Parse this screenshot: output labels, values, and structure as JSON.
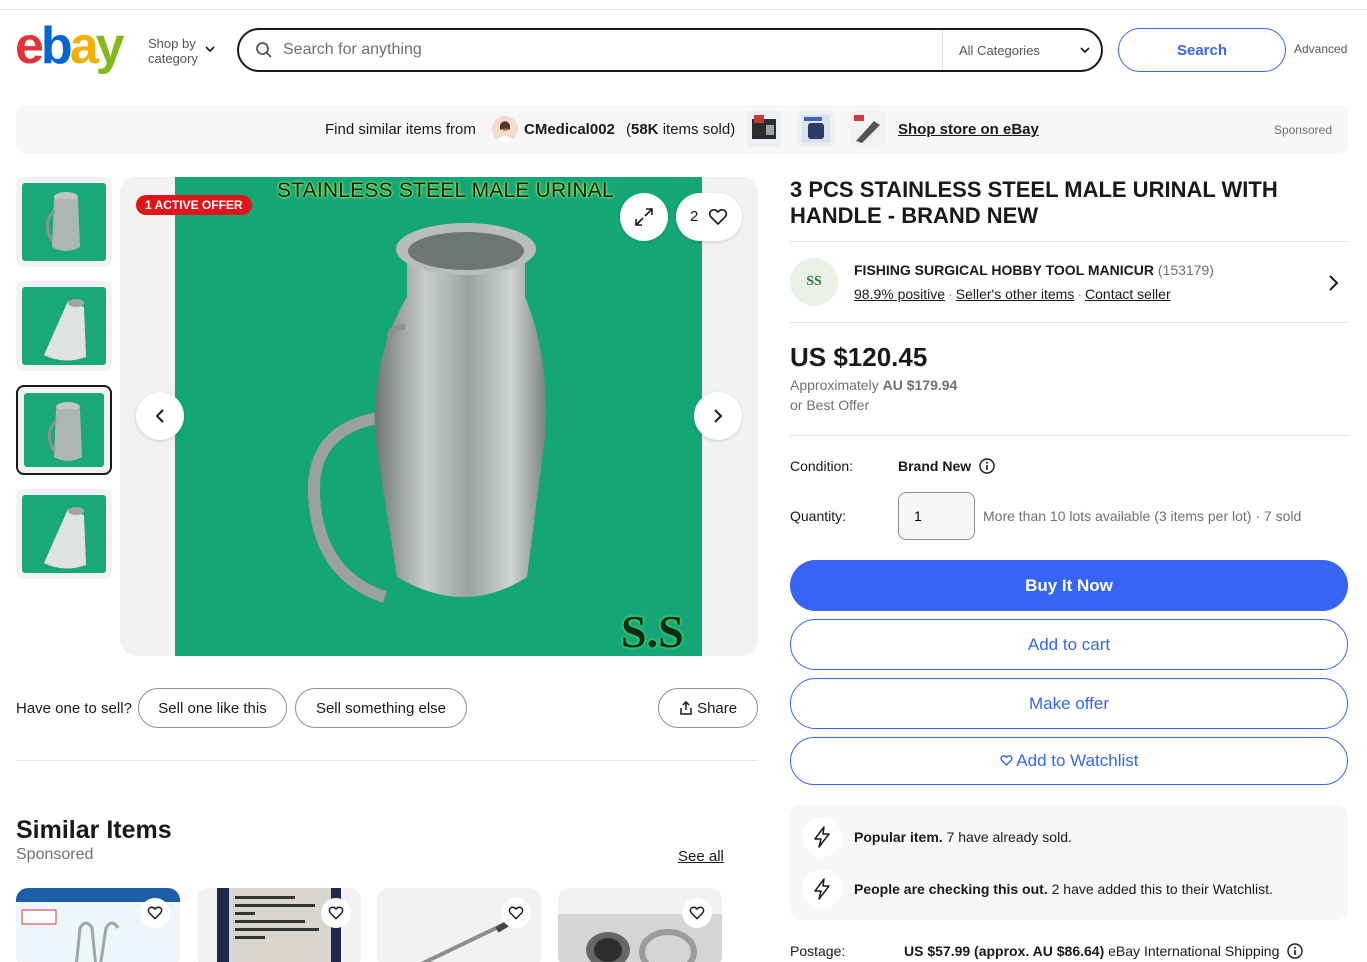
{
  "header": {
    "logo": {
      "e": "e",
      "b": "b",
      "a": "a",
      "y": "y"
    },
    "shop_by_line1": "Shop by",
    "shop_by_line2": "category",
    "search_placeholder": "Search for anything",
    "category": "All Categories",
    "search_button": "Search",
    "advanced": "Advanced"
  },
  "store_banner": {
    "find_similar": "Find similar items from",
    "store_name": "CMedical002",
    "sold_count": "58K",
    "sold_suffix": "items sold)",
    "sold_prefix": "(",
    "shop_store": "Shop store on eBay",
    "sponsored": "Sponsored"
  },
  "gallery": {
    "offer_badge": "1 ACTIVE OFFER",
    "image_caption": "STAINLESS STEEL MALE URINAL",
    "image_watermark": "S.S",
    "watch_count": "2",
    "selected_thumb": 3
  },
  "sell": {
    "prompt": "Have one to sell?",
    "sell_like": "Sell one like this",
    "sell_else": "Sell something else",
    "share": "Share"
  },
  "similar": {
    "title": "Similar Items",
    "sponsored": "Sponsored",
    "see_all": "See all"
  },
  "item": {
    "title": "3 PCS STAINLESS STEEL MALE URINAL WITH HANDLE - BRAND NEW",
    "seller_name": "FISHING SURGICAL HOBBY TOOL MANICUR",
    "seller_score": "(153179)",
    "seller_logo_text": "SS",
    "positive": "98.9% positive",
    "other_items": "Seller's other items",
    "contact": "Contact seller",
    "price": "US $120.45",
    "approx_prefix": "Approximately",
    "approx_value": "AU $179.94",
    "best_offer": "or Best Offer",
    "condition_label": "Condition:",
    "condition": "Brand New",
    "quantity_label": "Quantity:",
    "quantity": "1",
    "availability": "More than 10 lots available (3 items per lot) · 7 sold",
    "buy_now": "Buy It Now",
    "add_cart": "Add to cart",
    "make_offer": "Make offer",
    "watchlist": "Add to Watchlist"
  },
  "signals": {
    "s1_bold": "Popular item.",
    "s1_text": "7 have already sold.",
    "s2_bold": "People are checking this out.",
    "s2_text": "2 have added this to their Watchlist."
  },
  "postage": {
    "label": "Postage:",
    "value": "US $57.99 (approx. AU $86.64)",
    "method": "eBay International Shipping"
  },
  "colors": {
    "accent": "#3665f3",
    "badge": "#e0151b",
    "image_bg": "#15a678"
  }
}
